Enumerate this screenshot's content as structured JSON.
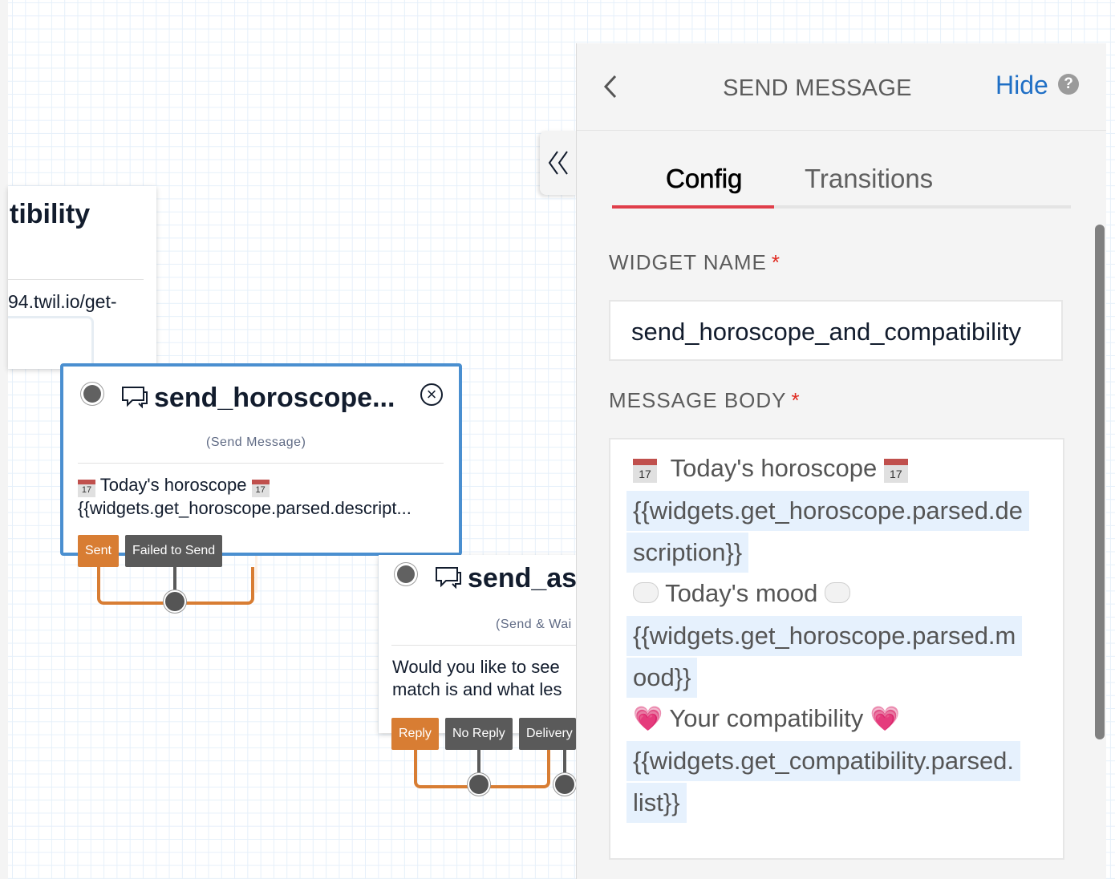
{
  "canvas": {
    "previous_widget": {
      "title_fragment": "tibility",
      "url_fragment": "94.twil.io/get-"
    },
    "widgets": [
      {
        "id": "send_horoscope",
        "title": "send_horoscope...",
        "type_label": "(Send Message)",
        "body_line1": "Today's horoscope",
        "body_line2": "{{widgets.get_horoscope.parsed.descript...",
        "calendar_emoji": "17",
        "selected": true,
        "ports": [
          {
            "label": "Sent",
            "color": "orange"
          },
          {
            "label": "Failed to Send",
            "color": "gray"
          }
        ]
      },
      {
        "id": "send_ask",
        "title": "send_as",
        "type_label": "(Send & Wai",
        "body_line1": "Would you like to see",
        "body_line2": "match is and what les",
        "selected": false,
        "ports": [
          {
            "label": "Reply",
            "color": "orange"
          },
          {
            "label": "No Reply",
            "color": "gray"
          },
          {
            "label": "Delivery",
            "color": "gray"
          }
        ]
      }
    ]
  },
  "collapse_tab": {
    "icon": "double-chevron-left",
    "glyph": "‹‹"
  },
  "panel": {
    "title": "SEND MESSAGE",
    "back_glyph": "‹",
    "hide_label": "Hide",
    "help_glyph": "?",
    "tabs": [
      {
        "label": "Config",
        "active": true
      },
      {
        "label": "Transitions",
        "active": false
      }
    ],
    "widget_name": {
      "label": "WIDGET NAME",
      "required_mark": "*",
      "value": "send_horoscope_and_compatibility"
    },
    "message_body": {
      "label": "MESSAGE BODY",
      "required_mark": "*",
      "lines": {
        "horoscope_heading": "Today's horoscope",
        "horoscope_var_1": "{{widgets.get_horoscope.parsed.de",
        "horoscope_var_2": "scription}}",
        "mood_heading": "Today's mood",
        "mood_var_1": "{{widgets.get_horoscope.parsed.m",
        "mood_var_2": "ood}}",
        "compat_heading": "Your compatibility",
        "compat_var_1": "{{widgets.get_compatibility.parsed.",
        "compat_var_2": "list}}"
      },
      "emoji": {
        "calendar": "17",
        "heart": "💗"
      }
    }
  },
  "colors": {
    "selected_border": "#4a8fd0",
    "port_orange": "#d87d33",
    "port_gray": "#5a5a5a",
    "tab_underline": "#e03e4a",
    "link_blue": "#1f6fc5",
    "required_red": "#e0281e",
    "variable_highlight": "#e6f1fd"
  }
}
